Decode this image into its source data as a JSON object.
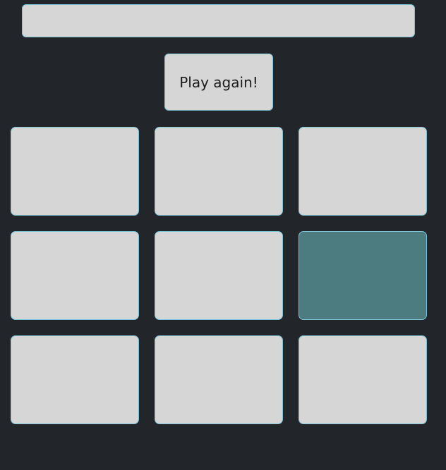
{
  "status": {
    "text": ""
  },
  "controls": {
    "play_again_label": "Play again!"
  },
  "board": {
    "cells": [
      {
        "mark": "",
        "highlighted": false
      },
      {
        "mark": "",
        "highlighted": false
      },
      {
        "mark": "",
        "highlighted": false
      },
      {
        "mark": "",
        "highlighted": false
      },
      {
        "mark": "",
        "highlighted": false
      },
      {
        "mark": "",
        "highlighted": true
      },
      {
        "mark": "",
        "highlighted": false
      },
      {
        "mark": "",
        "highlighted": false
      },
      {
        "mark": "",
        "highlighted": false
      }
    ]
  },
  "colors": {
    "background": "#22252a",
    "tile": "#d6d6d6",
    "tile_border": "#7cc3d6",
    "highlight": "#4c7b80"
  }
}
